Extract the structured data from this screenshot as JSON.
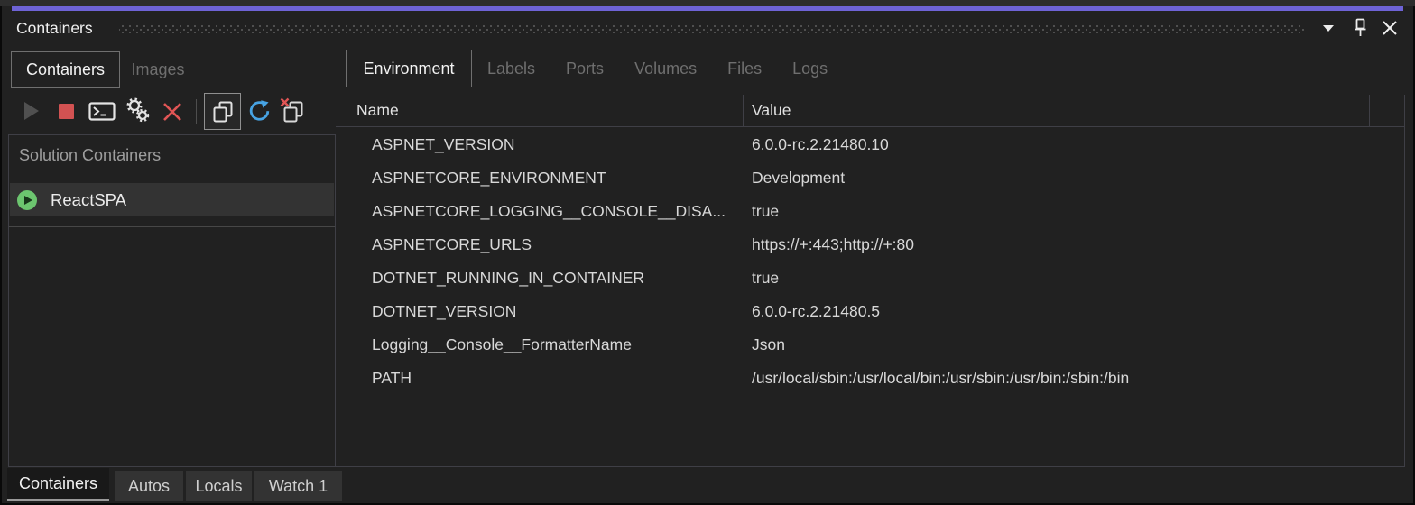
{
  "window": {
    "title": "Containers"
  },
  "title_bar": {
    "icons": [
      "chevron-down",
      "pin",
      "close"
    ]
  },
  "left_panel": {
    "tabs": [
      {
        "label": "Containers",
        "selected": true
      },
      {
        "label": "Images",
        "selected": false
      }
    ],
    "toolbar_icons": [
      "start",
      "stop",
      "open-terminal",
      "settings-gears",
      "remove",
      "group-containers",
      "refresh",
      "prune-containers"
    ],
    "tree": {
      "header": "Solution Containers",
      "items": [
        {
          "label": "ReactSPA",
          "status": "running",
          "selected": true
        }
      ]
    }
  },
  "right_panel": {
    "tabs": [
      {
        "label": "Environment",
        "selected": true
      },
      {
        "label": "Labels",
        "selected": false
      },
      {
        "label": "Ports",
        "selected": false
      },
      {
        "label": "Volumes",
        "selected": false
      },
      {
        "label": "Files",
        "selected": false
      },
      {
        "label": "Logs",
        "selected": false
      }
    ],
    "table": {
      "columns": [
        "Name",
        "Value"
      ],
      "rows": [
        {
          "name": "ASPNET_VERSION",
          "value": "6.0.0-rc.2.21480.10"
        },
        {
          "name": "ASPNETCORE_ENVIRONMENT",
          "value": "Development"
        },
        {
          "name": "ASPNETCORE_LOGGING__CONSOLE__DISA...",
          "value": "true"
        },
        {
          "name": "ASPNETCORE_URLS",
          "value": "https://+:443;http://+:80"
        },
        {
          "name": "DOTNET_RUNNING_IN_CONTAINER",
          "value": "true"
        },
        {
          "name": "DOTNET_VERSION",
          "value": "6.0.0-rc.2.21480.5"
        },
        {
          "name": "Logging__Console__FormatterName",
          "value": "Json"
        },
        {
          "name": "PATH",
          "value": "/usr/local/sbin:/usr/local/bin:/usr/sbin:/usr/bin:/sbin:/bin"
        }
      ]
    }
  },
  "bottom_tabs": [
    {
      "label": "Containers",
      "selected": true
    },
    {
      "label": "Autos",
      "selected": false
    },
    {
      "label": "Locals",
      "selected": false
    },
    {
      "label": "Watch 1",
      "selected": false
    }
  ],
  "colors": {
    "accent_purple": "#6e63d6",
    "refresh_blue": "#47a3e3",
    "stop_red": "#d25252",
    "delete_red": "#e15555",
    "running_green": "#6cc56f",
    "selection_gray": "#333333",
    "panel_border": "#3f3f46",
    "background": "#212121"
  }
}
